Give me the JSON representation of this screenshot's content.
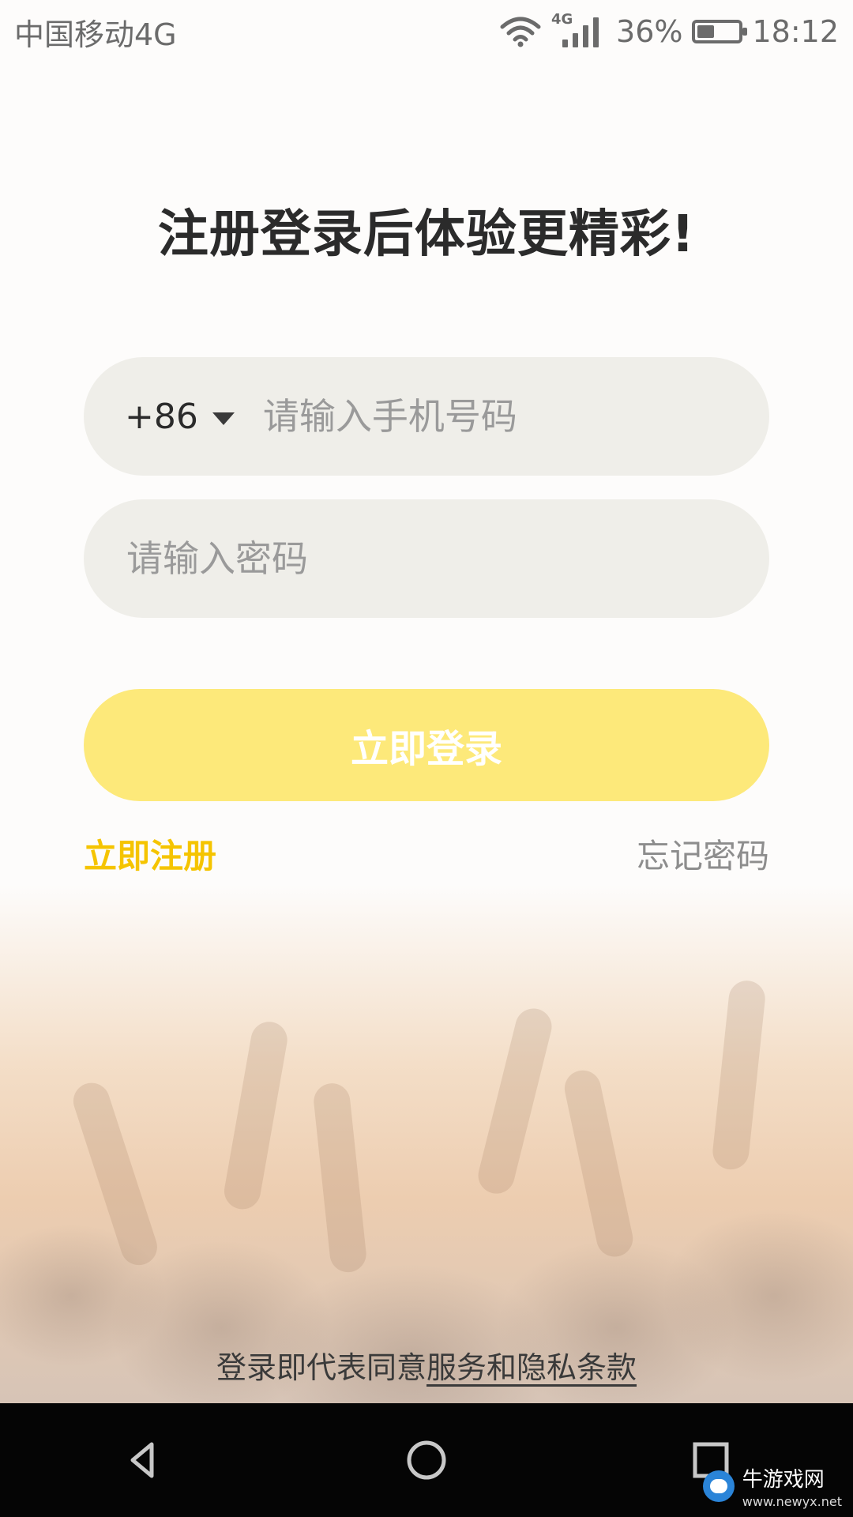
{
  "status_bar": {
    "carrier": "中国移动4G",
    "network_mini": "4G",
    "battery_percent": "36%",
    "battery_level": 0.36,
    "time": "18:12"
  },
  "login": {
    "title": "注册登录后体验更精彩!",
    "country_code": "+86",
    "phone_placeholder": "请输入手机号码",
    "password_placeholder": "请输入密码",
    "login_button_label": "立即登录",
    "register_label": "立即注册",
    "forgot_label": "忘记密码",
    "terms_prefix": "登录即代表同意",
    "terms_link": "服务和隐私条款"
  },
  "nav": {
    "back_icon": "back-triangle-icon",
    "home_icon": "home-circle-icon",
    "recents_icon": "recents-square-icon"
  },
  "watermark": {
    "text": "牛游戏网",
    "site": "www.newyx.net"
  },
  "colors": {
    "accent_yellow": "#f5c400",
    "button_yellow": "#fde97a",
    "field_bg": "#efeee9",
    "nav_bg": "#050505"
  }
}
